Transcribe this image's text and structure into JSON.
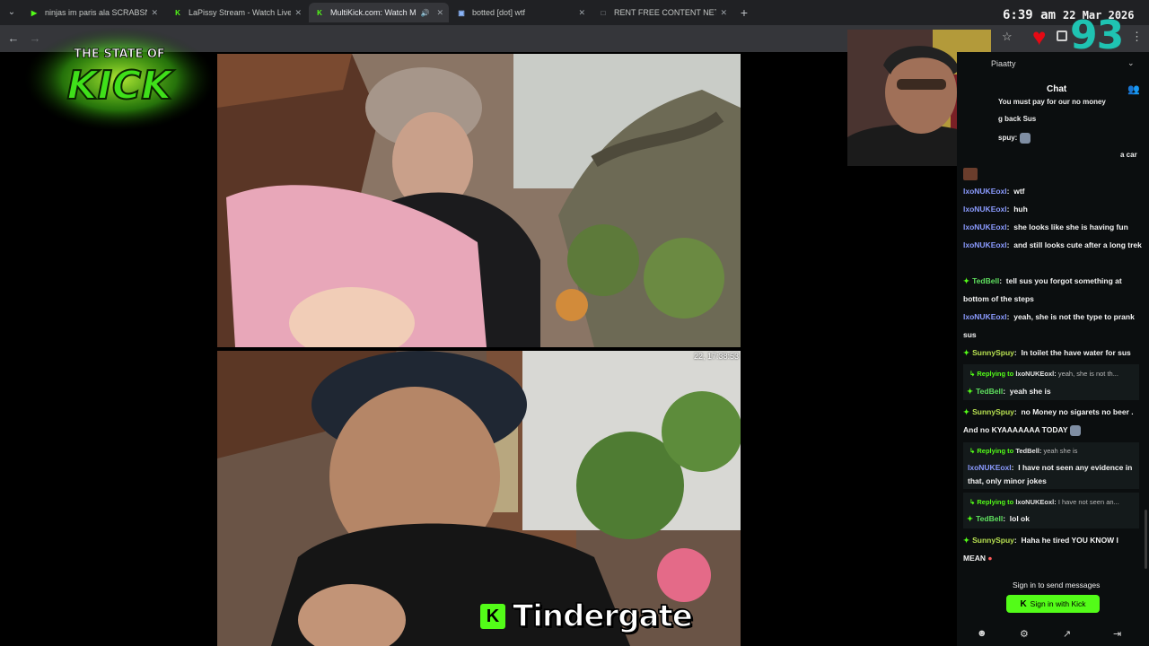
{
  "browser": {
    "tabs": [
      {
        "title": "ninjas im paris ala SCRABSNYC",
        "favicon": "play-icon",
        "color": "#53fc18"
      },
      {
        "title": "LaPissy Stream - Watch Live on",
        "favicon": "kick-icon",
        "color": "#53fc18"
      },
      {
        "title": "MultiKick.com: Watch Multi",
        "favicon": "multikick-icon",
        "color": "#53fc18"
      },
      {
        "title": "botted [dot] wtf",
        "favicon": "bot-icon",
        "color": "#8ab4f8"
      },
      {
        "title": "RENT FREE CONTENT NETWOR",
        "favicon": "page-icon",
        "color": "#9aa0a6"
      }
    ],
    "active_tab_index": 2,
    "clock_time": "6:39 am",
    "clock_date": "22 Mar 2026",
    "extension_count": "93"
  },
  "logo": {
    "line1": "THE STATE OF",
    "line2": "KICK"
  },
  "video": {
    "bottom_timestamp": "22, 17:38:53",
    "caption": "Tindergate",
    "caption_badge": "K"
  },
  "chat": {
    "top_label": "Piaatty",
    "header": "Chat",
    "partial_lines": [
      "You must pay for our no money",
      "g back Sus",
      "spuy:",
      "a car"
    ],
    "messages": [
      {
        "user": "lxoNUKEoxl",
        "text": "wtf",
        "color": "blue",
        "badge": false
      },
      {
        "user": "lxoNUKEoxl",
        "text": "huh",
        "color": "blue",
        "badge": false
      },
      {
        "user": "lxoNUKEoxl",
        "text": "she looks like she is having fun",
        "color": "blue",
        "badge": false
      },
      {
        "user": "lxoNUKEoxl",
        "text": "and still looks cute after a long trek",
        "color": "blue",
        "badge": false
      },
      {
        "user": "TedBell",
        "text": "tell sus you forgot something at bottom of the steps",
        "color": "green",
        "badge": true
      },
      {
        "user": "lxoNUKEoxl",
        "text": "yeah, she is not the type to prank sus",
        "color": "blue",
        "badge": false
      },
      {
        "user": "SunnySpuy",
        "text": "In toilet the have water for sus",
        "color": "yellow",
        "badge": true
      }
    ],
    "reply1": {
      "label": "Replying to",
      "to": "lxoNUKEoxl:",
      "quote": "yeah, she is not th...",
      "user": "TedBell",
      "text": "yeah she is"
    },
    "msg_sunny2": {
      "user": "SunnySpuy",
      "text": "no Money no sigarets no beer . And no KYAAAAAAA TODAY"
    },
    "reply2": {
      "label": "Replying to",
      "to": "TedBell:",
      "quote": "yeah she is",
      "user": "lxoNUKEoxl",
      "text": "I have not seen any evidence in that, only minor jokes"
    },
    "reply3": {
      "label": "Replying to",
      "to": "lxoNUKEoxl:",
      "quote": "I have not seen an...",
      "user": "TedBell",
      "text": "lol ok"
    },
    "msg_sunny3": {
      "user": "SunnySpuy",
      "text": "Haha he tired YOU KNOW I MEAN"
    },
    "signin_prompt": "Sign in to send messages",
    "signin_button": "Sign in with Kick",
    "signin_button_icon": "K"
  }
}
